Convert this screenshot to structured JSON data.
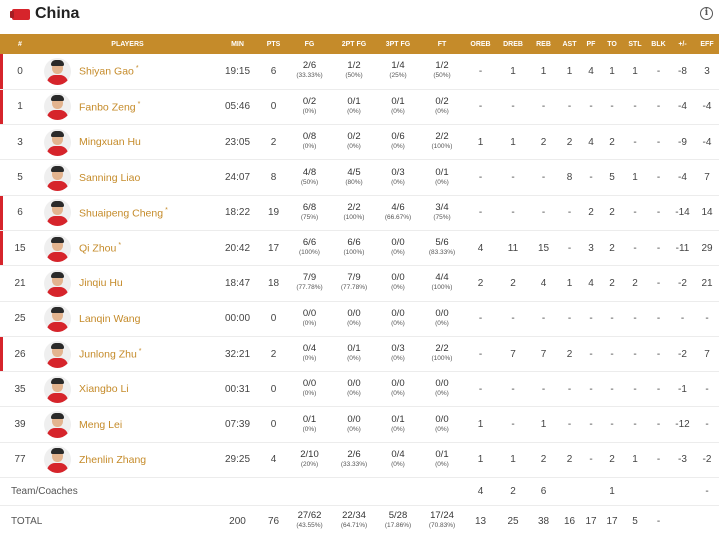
{
  "team": {
    "name": "China",
    "flag_color": "#d6242b",
    "accent_color": "#c58b2a"
  },
  "columns": [
    "#",
    "PLAYERS",
    "MIN",
    "PTS",
    "FG",
    "2PT FG",
    "3PT FG",
    "FT",
    "OREB",
    "DREB",
    "REB",
    "AST",
    "PF",
    "TO",
    "STL",
    "BLK",
    "+/-",
    "EFF"
  ],
  "players": [
    {
      "num": "0",
      "name": "Shiyan Gao",
      "starter": true,
      "min": "19:15",
      "pts": "6",
      "fg": "2/6",
      "fg_pct": "(33.33%)",
      "p2": "1/2",
      "p2_pct": "(50%)",
      "p3": "1/4",
      "p3_pct": "(25%)",
      "ft": "1/2",
      "ft_pct": "(50%)",
      "oreb": "-",
      "dreb": "1",
      "reb": "1",
      "ast": "1",
      "pf": "4",
      "to": "1",
      "stl": "1",
      "blk": "-",
      "pm": "-8",
      "eff": "3"
    },
    {
      "num": "1",
      "name": "Fanbo Zeng",
      "starter": true,
      "min": "05:46",
      "pts": "0",
      "fg": "0/2",
      "fg_pct": "(0%)",
      "p2": "0/1",
      "p2_pct": "(0%)",
      "p3": "0/1",
      "p3_pct": "(0%)",
      "ft": "0/2",
      "ft_pct": "(0%)",
      "oreb": "-",
      "dreb": "-",
      "reb": "-",
      "ast": "-",
      "pf": "-",
      "to": "-",
      "stl": "-",
      "blk": "-",
      "pm": "-4",
      "eff": "-4"
    },
    {
      "num": "3",
      "name": "Mingxuan Hu",
      "starter": false,
      "min": "23:05",
      "pts": "2",
      "fg": "0/8",
      "fg_pct": "(0%)",
      "p2": "0/2",
      "p2_pct": "(0%)",
      "p3": "0/6",
      "p3_pct": "(0%)",
      "ft": "2/2",
      "ft_pct": "(100%)",
      "oreb": "1",
      "dreb": "1",
      "reb": "2",
      "ast": "2",
      "pf": "4",
      "to": "2",
      "stl": "-",
      "blk": "-",
      "pm": "-9",
      "eff": "-4"
    },
    {
      "num": "5",
      "name": "Sanning Liao",
      "starter": false,
      "min": "24:07",
      "pts": "8",
      "fg": "4/8",
      "fg_pct": "(50%)",
      "p2": "4/5",
      "p2_pct": "(80%)",
      "p3": "0/3",
      "p3_pct": "(0%)",
      "ft": "0/1",
      "ft_pct": "(0%)",
      "oreb": "-",
      "dreb": "-",
      "reb": "-",
      "ast": "8",
      "pf": "-",
      "to": "5",
      "stl": "1",
      "blk": "-",
      "pm": "-4",
      "eff": "7"
    },
    {
      "num": "6",
      "name": "Shuaipeng Cheng",
      "starter": true,
      "min": "18:22",
      "pts": "19",
      "fg": "6/8",
      "fg_pct": "(75%)",
      "p2": "2/2",
      "p2_pct": "(100%)",
      "p3": "4/6",
      "p3_pct": "(66.67%)",
      "ft": "3/4",
      "ft_pct": "(75%)",
      "oreb": "-",
      "dreb": "-",
      "reb": "-",
      "ast": "-",
      "pf": "2",
      "to": "2",
      "stl": "-",
      "blk": "-",
      "pm": "-14",
      "eff": "14"
    },
    {
      "num": "15",
      "name": "Qi Zhou",
      "starter": true,
      "min": "20:42",
      "pts": "17",
      "fg": "6/6",
      "fg_pct": "(100%)",
      "p2": "6/6",
      "p2_pct": "(100%)",
      "p3": "0/0",
      "p3_pct": "(0%)",
      "ft": "5/6",
      "ft_pct": "(83.33%)",
      "oreb": "4",
      "dreb": "11",
      "reb": "15",
      "ast": "-",
      "pf": "3",
      "to": "2",
      "stl": "-",
      "blk": "-",
      "pm": "-11",
      "eff": "29"
    },
    {
      "num": "21",
      "name": "Jinqiu Hu",
      "starter": false,
      "min": "18:47",
      "pts": "18",
      "fg": "7/9",
      "fg_pct": "(77.78%)",
      "p2": "7/9",
      "p2_pct": "(77.78%)",
      "p3": "0/0",
      "p3_pct": "(0%)",
      "ft": "4/4",
      "ft_pct": "(100%)",
      "oreb": "2",
      "dreb": "2",
      "reb": "4",
      "ast": "1",
      "pf": "4",
      "to": "2",
      "stl": "2",
      "blk": "-",
      "pm": "-2",
      "eff": "21"
    },
    {
      "num": "25",
      "name": "Lanqin Wang",
      "starter": false,
      "min": "00:00",
      "pts": "0",
      "fg": "0/0",
      "fg_pct": "(0%)",
      "p2": "0/0",
      "p2_pct": "(0%)",
      "p3": "0/0",
      "p3_pct": "(0%)",
      "ft": "0/0",
      "ft_pct": "(0%)",
      "oreb": "-",
      "dreb": "-",
      "reb": "-",
      "ast": "-",
      "pf": "-",
      "to": "-",
      "stl": "-",
      "blk": "-",
      "pm": "-",
      "eff": "-"
    },
    {
      "num": "26",
      "name": "Junlong Zhu",
      "starter": true,
      "min": "32:21",
      "pts": "2",
      "fg": "0/4",
      "fg_pct": "(0%)",
      "p2": "0/1",
      "p2_pct": "(0%)",
      "p3": "0/3",
      "p3_pct": "(0%)",
      "ft": "2/2",
      "ft_pct": "(100%)",
      "oreb": "-",
      "dreb": "7",
      "reb": "7",
      "ast": "2",
      "pf": "-",
      "to": "-",
      "stl": "-",
      "blk": "-",
      "pm": "-2",
      "eff": "7"
    },
    {
      "num": "35",
      "name": "Xiangbo Li",
      "starter": false,
      "min": "00:31",
      "pts": "0",
      "fg": "0/0",
      "fg_pct": "(0%)",
      "p2": "0/0",
      "p2_pct": "(0%)",
      "p3": "0/0",
      "p3_pct": "(0%)",
      "ft": "0/0",
      "ft_pct": "(0%)",
      "oreb": "-",
      "dreb": "-",
      "reb": "-",
      "ast": "-",
      "pf": "-",
      "to": "-",
      "stl": "-",
      "blk": "-",
      "pm": "-1",
      "eff": "-"
    },
    {
      "num": "39",
      "name": "Meng Lei",
      "starter": false,
      "min": "07:39",
      "pts": "0",
      "fg": "0/1",
      "fg_pct": "(0%)",
      "p2": "0/0",
      "p2_pct": "(0%)",
      "p3": "0/1",
      "p3_pct": "(0%)",
      "ft": "0/0",
      "ft_pct": "(0%)",
      "oreb": "1",
      "dreb": "-",
      "reb": "1",
      "ast": "-",
      "pf": "-",
      "to": "-",
      "stl": "-",
      "blk": "-",
      "pm": "-12",
      "eff": "-"
    },
    {
      "num": "77",
      "name": "Zhenlin Zhang",
      "starter": false,
      "min": "29:25",
      "pts": "4",
      "fg": "2/10",
      "fg_pct": "(20%)",
      "p2": "2/6",
      "p2_pct": "(33.33%)",
      "p3": "0/4",
      "p3_pct": "(0%)",
      "ft": "0/1",
      "ft_pct": "(0%)",
      "oreb": "1",
      "dreb": "1",
      "reb": "2",
      "ast": "2",
      "pf": "-",
      "to": "2",
      "stl": "1",
      "blk": "-",
      "pm": "-3",
      "eff": "-2"
    }
  ],
  "team_coaches": {
    "label": "Team/Coaches",
    "oreb": "4",
    "dreb": "2",
    "reb": "6",
    "to": "1",
    "eff": "-"
  },
  "total": {
    "label": "TOTAL",
    "min": "200",
    "pts": "76",
    "fg": "27/62",
    "fg_pct": "(43.55%)",
    "p2": "22/34",
    "p2_pct": "(64.71%)",
    "p3": "5/28",
    "p3_pct": "(17.86%)",
    "ft": "17/24",
    "ft_pct": "(70.83%)",
    "oreb": "13",
    "dreb": "25",
    "reb": "38",
    "ast": "16",
    "pf": "17",
    "to": "17",
    "stl": "5",
    "blk": "-",
    "pm": "",
    "eff": ""
  }
}
